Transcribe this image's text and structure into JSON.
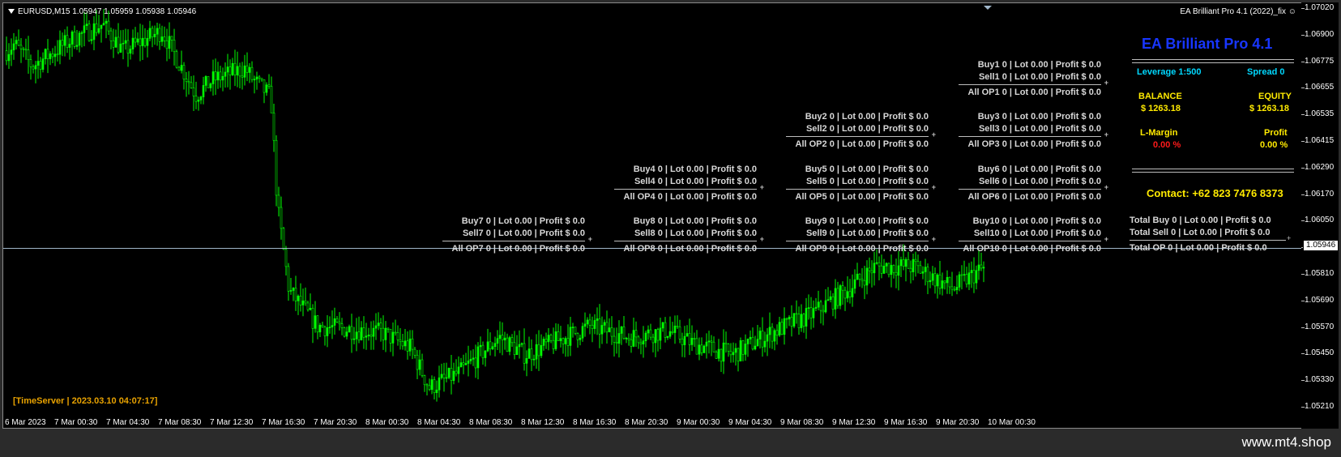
{
  "header": {
    "symbol_info": "EURUSD,M15 1.05947 1.05959 1.05938 1.05946",
    "ea_name": "EA Brilliant Pro 4.1 (2022)_fix"
  },
  "colors": {
    "candles": "#00ff00",
    "background": "#000000",
    "title": "#1836ff",
    "cyan": "#00d8ff",
    "yellow": "#ffea00",
    "red": "#ff1a1a",
    "orange": "#e8a200"
  },
  "current_price": "1.05946",
  "y_axis": {
    "labels": [
      "1.07020",
      "1.06900",
      "1.06775",
      "1.06655",
      "1.06535",
      "1.06415",
      "1.06290",
      "1.06170",
      "1.06050",
      "1.05930",
      "1.05810",
      "1.05690",
      "1.05570",
      "1.05450",
      "1.05330",
      "1.05210"
    ],
    "min": 1.0521,
    "max": 1.0702
  },
  "x_axis": {
    "labels": [
      "6 Mar 2023",
      "7 Mar 00:30",
      "7 Mar 04:30",
      "7 Mar 08:30",
      "7 Mar 12:30",
      "7 Mar 16:30",
      "7 Mar 20:30",
      "8 Mar 00:30",
      "8 Mar 04:30",
      "8 Mar 08:30",
      "8 Mar 12:30",
      "8 Mar 16:30",
      "8 Mar 20:30",
      "9 Mar 00:30",
      "9 Mar 04:30",
      "9 Mar 08:30",
      "9 Mar 12:30",
      "9 Mar 16:30",
      "9 Mar 20:30",
      "10 Mar 00:30"
    ]
  },
  "price_path": [
    [
      0,
      1.0683
    ],
    [
      0.3,
      1.0686
    ],
    [
      1,
      1.0676
    ],
    [
      2.5,
      1.0688
    ],
    [
      3.7,
      1.0695
    ],
    [
      4.5,
      1.0683
    ],
    [
      6,
      1.0692
    ],
    [
      7,
      1.067
    ],
    [
      7.3,
      1.0663
    ],
    [
      8,
      1.067
    ],
    [
      9.2,
      1.0675
    ],
    [
      9.5,
      1.067
    ],
    [
      10.2,
      1.0662
    ],
    [
      10.45,
      1.0612
    ],
    [
      10.9,
      1.0574
    ],
    [
      12,
      1.0558
    ],
    [
      14.5,
      1.0555
    ],
    [
      15.6,
      1.0548
    ],
    [
      16.3,
      1.053
    ],
    [
      17.5,
      1.0537
    ],
    [
      19,
      1.0553
    ],
    [
      20,
      1.0545
    ],
    [
      21,
      1.055
    ],
    [
      22.5,
      1.0558
    ],
    [
      24,
      1.0553
    ],
    [
      25.5,
      1.0556
    ],
    [
      26.5,
      1.055
    ],
    [
      28,
      1.0545
    ],
    [
      29.5,
      1.0555
    ],
    [
      31,
      1.0563
    ],
    [
      32.5,
      1.0575
    ],
    [
      33.5,
      1.0585
    ],
    [
      35,
      1.0585
    ],
    [
      36.5,
      1.0575
    ],
    [
      37.5,
      1.0583
    ],
    [
      38.3,
      1.0587
    ],
    [
      38.8,
      1.0585
    ],
    [
      39.5,
      1.0593
    ]
  ],
  "timeserver": "[TimeServer | 2023.03.10 04:07:17]",
  "groups": [
    {
      "rows": [
        "Buy1   0  |  Lot 0.00  |  Profit $ 0.0",
        "Sell1   0  |  Lot 0.00  |  Profit $ 0.0",
        "All OP1   0  |  Lot 0.00  |  Profit $ 0.0"
      ]
    },
    {
      "rows": [
        "Buy2   0  |  Lot 0.00  |  Profit $ 0.0",
        "Sell2   0  |  Lot 0.00  |  Profit $ 0.0",
        "All OP2   0  |  Lot 0.00  |  Profit $ 0.0"
      ]
    },
    {
      "rows": [
        "Buy3   0  |  Lot 0.00  |  Profit $ 0.0",
        "Sell3   0  |  Lot 0.00  |  Profit $ 0.0",
        "All OP3   0  |  Lot 0.00  |  Profit $ 0.0"
      ]
    },
    {
      "rows": [
        "Buy4   0  |  Lot 0.00  |  Profit $ 0.0",
        "Sell4   0  |  Lot 0.00  |  Profit $ 0.0",
        "All OP4   0  |  Lot 0.00  |  Profit $ 0.0"
      ]
    },
    {
      "rows": [
        "Buy5   0  |  Lot 0.00  |  Profit $ 0.0",
        "Sell5   0  |  Lot 0.00  |  Profit $ 0.0",
        "All OP5   0  |  Lot 0.00  |  Profit $ 0.0"
      ]
    },
    {
      "rows": [
        "Buy6   0  |  Lot 0.00  |  Profit $ 0.0",
        "Sell6   0  |  Lot 0.00  |  Profit $ 0.0",
        "All OP6   0  |  Lot 0.00  |  Profit $ 0.0"
      ]
    },
    {
      "rows": [
        "Buy7   0  |  Lot 0.00  |  Profit $ 0.0",
        "Sell7   0  |  Lot 0.00  |  Profit $ 0.0",
        "All OP7   0  |  Lot 0.00  |  Profit $ 0.0"
      ]
    },
    {
      "rows": [
        "Buy8   0  |  Lot 0.00  |  Profit $ 0.0",
        "Sell8   0  |  Lot 0.00  |  Profit $ 0.0",
        "All OP8   0  |  Lot 0.00  |  Profit $ 0.0"
      ]
    },
    {
      "rows": [
        "Buy9   0  |  Lot 0.00  |  Profit $ 0.0",
        "Sell9   0  |  Lot 0.00  |  Profit $ 0.0",
        "All OP9   0  |  Lot 0.00  |  Profit $ 0.0"
      ]
    },
    {
      "rows": [
        "Buy10   0  |  Lot 0.00  |  Profit $ 0.0",
        "Sell10   0  |  Lot 0.00  |  Profit $ 0.0",
        "All OP10   0  |  Lot 0.00  |  Profit $ 0.0"
      ]
    }
  ],
  "panel": {
    "title": "EA Brilliant Pro 4.1",
    "leverage": "Leverage  1:500",
    "spread": "Spread   0",
    "balance_label": "BALANCE",
    "balance_value": "$ 1263.18",
    "equity_label": "EQUITY",
    "equity_value": "$ 1263.18",
    "lmargin_label": "L-Margin",
    "lmargin_value": "0.00 %",
    "profit_label": "Profit",
    "profit_value": "0.00 %",
    "contact": "Contact: +62 823 7476 8373",
    "total_buy": "Total Buy   0  |  Lot 0.00  |  Profit $ 0.0",
    "total_sell": "Total Sell   0  |  Lot 0.00  |  Profit $ 0.0",
    "total_op": "Total OP    0  |  Lot 0.00  |  Profit $ 0.0"
  },
  "brand": "www.mt4.shop"
}
